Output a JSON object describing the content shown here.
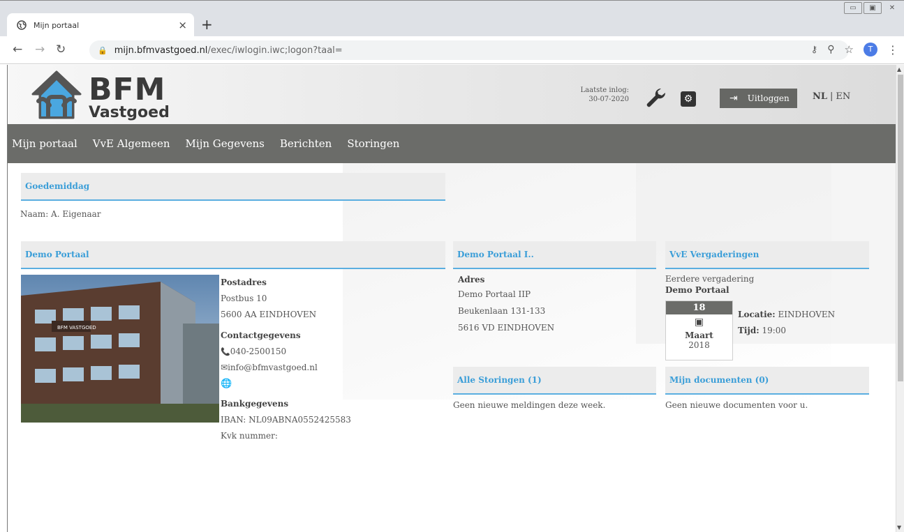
{
  "browser": {
    "tab_title": "Mijn portaal",
    "tab_close": "×",
    "new_tab": "+",
    "url_host": "mijn.bfmvastgoed.nl",
    "url_path": "/exec/iwlogin.iwc;logon?taal=",
    "avatar_letter": "T"
  },
  "header": {
    "logo_top": "BFM",
    "logo_bottom": "Vastgoed",
    "last_login_label": "Laatste inlog:",
    "last_login_date": "30-07-2020",
    "logout_label": "Uitloggen",
    "lang_nl": "NL",
    "lang_sep": "|",
    "lang_en": "EN"
  },
  "nav": {
    "items": [
      "Mijn portaal",
      "VvE Algemeen",
      "Mijn Gegevens",
      "Berichten",
      "Storingen"
    ]
  },
  "greeting": {
    "title": "Goedemiddag",
    "name_line": "Naam: A. Eigenaar"
  },
  "demo_portaal": {
    "title": "Demo Portaal",
    "postadres_label": "Postadres",
    "postadres_1": "Postbus 10",
    "postadres_2": "5600 AA EINDHOVEN",
    "contact_label": "Contactgegevens",
    "phone": "040-2500150",
    "email": "info@bfmvastgoed.nl",
    "bank_label": "Bankgegevens",
    "iban": "IBAN: NL09ABNA0552425583",
    "kvk": "Kvk nummer:",
    "photo_sign": "BFM VASTGOED"
  },
  "demo_portaal_2": {
    "title": "Demo Portaal I..",
    "adres_label": "Adres",
    "line1": "Demo Portaal IIP",
    "line2": "Beukenlaan 131-133",
    "line3": "5616 VD EINDHOVEN"
  },
  "vergaderingen": {
    "title": "VvE Vergaderingen",
    "sub": "Eerdere vergadering",
    "name": "Demo Portaal",
    "day": "18",
    "month": "Maart",
    "year": "2018",
    "locatie_label": "Locatie:",
    "locatie_value": "EINDHOVEN",
    "tijd_label": "Tijd:",
    "tijd_value": "19:00"
  },
  "storingen": {
    "title": "Alle Storingen (1)",
    "text": "Geen nieuwe meldingen deze week."
  },
  "documenten": {
    "title": "Mijn documenten (0)",
    "text": "Geen nieuwe documenten voor u."
  },
  "colors": {
    "accent": "#3b9ed8",
    "nav_bg": "#6b6c69"
  }
}
